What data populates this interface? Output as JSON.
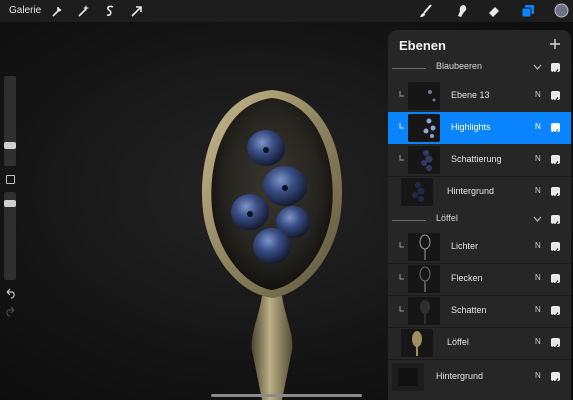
{
  "topbar": {
    "gallery_label": "Galerie",
    "left_tools": [
      "wrench-icon",
      "magic-wand-icon",
      "selection-s-icon",
      "transform-arrow-icon"
    ],
    "right_tools": [
      "brush-icon",
      "smudge-icon",
      "eraser-icon",
      "layers-icon",
      "color-swatch-icon"
    ],
    "accent": "#0a84ff"
  },
  "layers_panel": {
    "title": "Ebenen",
    "items": [
      {
        "kind": "group",
        "name": "Blaubeeren",
        "visible": true
      },
      {
        "kind": "layer",
        "name": "Ebene 13",
        "mode": "N",
        "clipped": true,
        "selected": false,
        "visible": true
      },
      {
        "kind": "layer",
        "name": "Highlights",
        "mode": "N",
        "clipped": true,
        "selected": true,
        "visible": true
      },
      {
        "kind": "layer",
        "name": "Schattierung",
        "mode": "N",
        "clipped": true,
        "selected": false,
        "visible": true
      },
      {
        "kind": "layer",
        "name": "Hintergrund",
        "mode": "N",
        "clipped": false,
        "selected": false,
        "visible": true
      },
      {
        "kind": "group",
        "name": "Löffel",
        "visible": true
      },
      {
        "kind": "layer",
        "name": "Lichter",
        "mode": "N",
        "clipped": true,
        "selected": false,
        "visible": true
      },
      {
        "kind": "layer",
        "name": "Flecken",
        "mode": "N",
        "clipped": true,
        "selected": false,
        "visible": true
      },
      {
        "kind": "layer",
        "name": "Schatten",
        "mode": "N",
        "clipped": true,
        "selected": false,
        "visible": true
      },
      {
        "kind": "layer",
        "name": "Löffel",
        "mode": "N",
        "clipped": false,
        "selected": false,
        "visible": true
      },
      {
        "kind": "layer",
        "name": "Hintergrund",
        "mode": "N",
        "clipped": false,
        "selected": false,
        "visible": true
      }
    ]
  }
}
